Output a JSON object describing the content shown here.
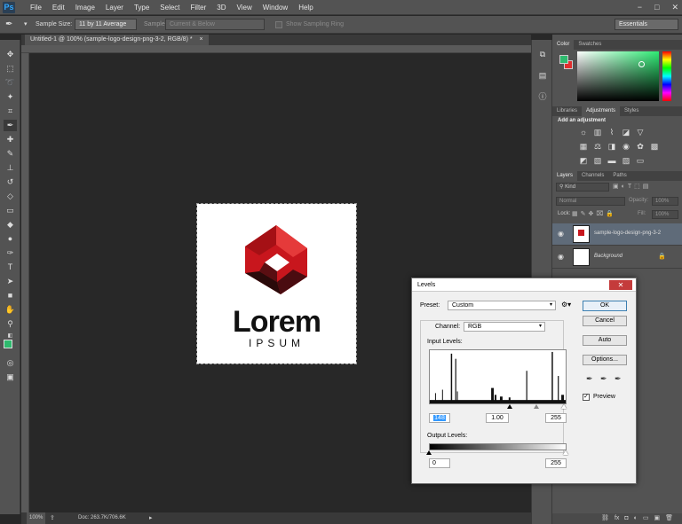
{
  "app": {
    "logo": "Ps"
  },
  "menu": [
    "File",
    "Edit",
    "Image",
    "Layer",
    "Type",
    "Select",
    "Filter",
    "3D",
    "View",
    "Window",
    "Help"
  ],
  "window_controls": {
    "minimize": "−",
    "restore": "□",
    "close": "✕"
  },
  "options": {
    "sample_size_label": "Sample Size:",
    "sample_size_value": "11 by 11 Average",
    "sample_label": "Sample:",
    "sample_value": "Current & Below",
    "show_ring": "Show Sampling Ring",
    "workspace": "Essentials"
  },
  "document": {
    "tab_title": "Untitled-1 @ 100% (sample-logo-design-png-3-2, RGB/8) *",
    "logo_word": "Lorem",
    "logo_sub": "IPSUM",
    "status_zoom": "100%",
    "status_doc": "Doc: 263.7K/706.6K"
  },
  "panels": {
    "color_tabs": [
      "Color",
      "Swatches"
    ],
    "adj_tabs": [
      "Libraries",
      "Adjustments",
      "Styles"
    ],
    "adj_title": "Add an adjustment",
    "layers_tabs": [
      "Layers",
      "Channels",
      "Paths"
    ],
    "kind": "Kind",
    "blend": "Normal",
    "opacity_label": "Opacity:",
    "opacity": "100%",
    "lock_label": "Lock:",
    "fill_label": "Fill:",
    "fill": "100%",
    "layers": [
      {
        "name": "sample-logo-design-png-3-2",
        "selected": true
      },
      {
        "name": "Background",
        "selected": false
      }
    ]
  },
  "levels": {
    "title": "Levels",
    "preset_label": "Preset:",
    "preset_value": "Custom",
    "channel_label": "Channel:",
    "channel_value": "RGB",
    "input_label": "Input Levels:",
    "input_black": "148",
    "input_gamma": "1.00",
    "input_white": "255",
    "output_label": "Output Levels:",
    "output_black": "0",
    "output_white": "255",
    "buttons": {
      "ok": "OK",
      "cancel": "Cancel",
      "auto": "Auto",
      "options": "Options..."
    },
    "preview_label": "Preview",
    "preview_checked": true
  },
  "colors": {
    "foreground": "#2eba6e",
    "background": "#e02d2d",
    "logo_red": "#c8161d"
  }
}
